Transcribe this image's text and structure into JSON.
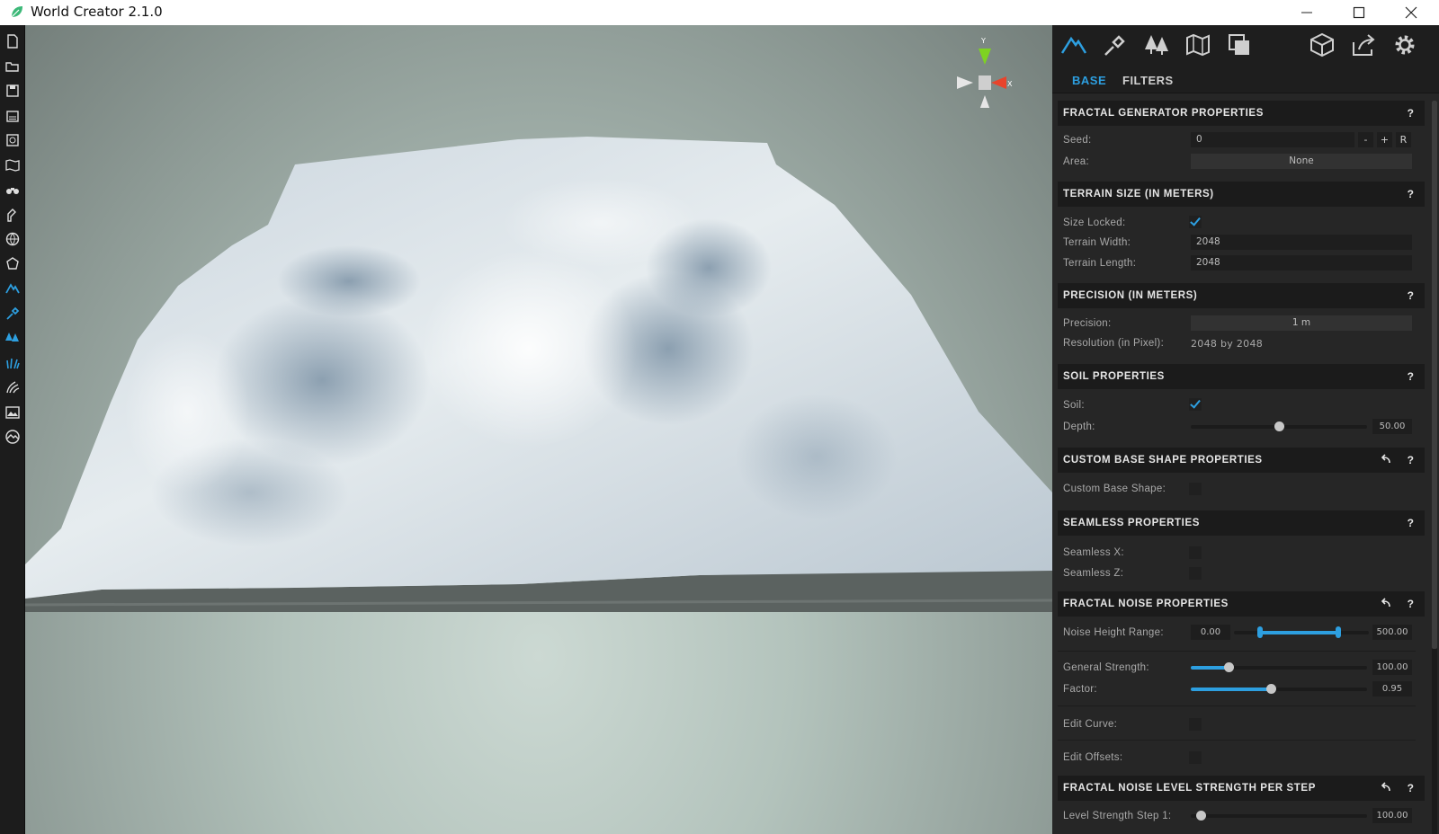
{
  "window": {
    "title": "World Creator 2.1.0"
  },
  "panel": {
    "tabs": [
      {
        "label": "BASE",
        "active": true
      },
      {
        "label": "FILTERS",
        "active": false
      }
    ],
    "top_icons": [
      "terrain-icon",
      "brush-icon",
      "trees-icon",
      "map-icon",
      "layers-icon",
      "cube-icon",
      "export-icon",
      "gear-icon"
    ],
    "help_label": "?",
    "sections": {
      "fractal_generator": {
        "title": "FRACTAL GENERATOR PROPERTIES",
        "seed_label": "Seed:",
        "seed_value": "0",
        "seed_minus": "-",
        "seed_plus": "+",
        "seed_random": "R",
        "area_label": "Area:",
        "area_value": "None"
      },
      "terrain_size": {
        "title": "TERRAIN SIZE (IN METERS)",
        "size_locked_label": "Size Locked:",
        "size_locked": true,
        "width_label": "Terrain Width:",
        "width_value": "2048",
        "length_label": "Terrain Length:",
        "length_value": "2048"
      },
      "precision": {
        "title": "PRECISION (IN METERS)",
        "precision_label": "Precision:",
        "precision_value": "1 m",
        "resolution_label": "Resolution (in Pixel):",
        "resolution_value": "2048 by 2048"
      },
      "soil": {
        "title": "SOIL PROPERTIES",
        "soil_label": "Soil:",
        "soil_checked": true,
        "depth_label": "Depth:",
        "depth_value": "50.00",
        "depth_fraction": 0.5
      },
      "custom_base_shape": {
        "title": "CUSTOM BASE SHAPE PROPERTIES",
        "label": "Custom Base Shape:",
        "checked": false
      },
      "seamless": {
        "title": "SEAMLESS PROPERTIES",
        "x_label": "Seamless X:",
        "x_checked": false,
        "z_label": "Seamless Z:",
        "z_checked": false
      },
      "fractal_noise": {
        "title": "FRACTAL NOISE PROPERTIES",
        "height_range_label": "Noise Height Range:",
        "height_min": "0.00",
        "height_max": "500.00",
        "strength_label": "General Strength:",
        "strength_value": "100.00",
        "strength_fraction": 0.22,
        "factor_label": "Factor:",
        "factor_value": "0.95",
        "factor_fraction": 0.46,
        "edit_curve_label": "Edit Curve:",
        "edit_offsets_label": "Edit Offsets:"
      },
      "level_strength": {
        "title": "FRACTAL NOISE LEVEL STRENGTH PER STEP",
        "step1_label": "Level Strength Step 1:",
        "step1_value": "100.00"
      }
    }
  },
  "gizmo": {
    "y_label": "Y",
    "x_label": "X"
  },
  "colors": {
    "accent": "#2d9fe0",
    "panel_bg": "#262626",
    "header_bg": "#1b1b1b"
  }
}
